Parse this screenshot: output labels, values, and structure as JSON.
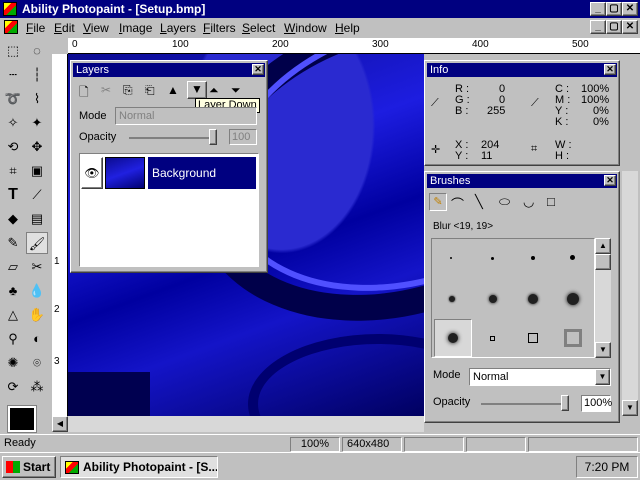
{
  "window": {
    "title": "Ability Photopaint - [Setup.bmp]",
    "min_glyph": "_",
    "max_glyph": "▢",
    "close_glyph": "✕"
  },
  "menu": [
    "File",
    "Edit",
    "View",
    "Image",
    "Layers",
    "Filters",
    "Select",
    "Window",
    "Help"
  ],
  "ruler": {
    "h_labels": [
      "0",
      "100",
      "200",
      "300",
      "400",
      "500"
    ],
    "v_labels": [
      "1",
      "2",
      "3"
    ]
  },
  "layers_panel": {
    "title": "Layers",
    "tooltip": "Layer Down",
    "mode_label": "Mode",
    "mode_value": "Normal",
    "opacity_label": "Opacity",
    "opacity_value": "100",
    "layer_name": "Background"
  },
  "info_panel": {
    "title": "Info",
    "r": "R :",
    "r_val": "0",
    "g": "G :",
    "g_val": "0",
    "b": "B :",
    "b_val": "255",
    "c": "C :",
    "c_val": "100%",
    "m": "M :",
    "m_val": "100%",
    "y": "Y :",
    "y_val": "0%",
    "k": "K :",
    "k_val": "0%",
    "x": "X :",
    "x_val": "204",
    "yy": "Y :",
    "yy_val": "11",
    "w": "W :",
    "w_val": "",
    "h": "H :",
    "h_val": ""
  },
  "brushes_panel": {
    "title": "Brushes",
    "brush_name": "Blur <19, 19>",
    "mode_label": "Mode",
    "mode_value": "Normal",
    "opacity_label": "Opacity",
    "opacity_value": "100%"
  },
  "status": {
    "ready": "Ready",
    "zoom": "100%",
    "size": "640x480"
  },
  "taskbar": {
    "start": "Start",
    "task": "Ability Photopaint - [S...",
    "clock": "7:20 PM"
  },
  "colors": {
    "titlebar": "#000080",
    "canvas_blue": "#1010d0"
  }
}
